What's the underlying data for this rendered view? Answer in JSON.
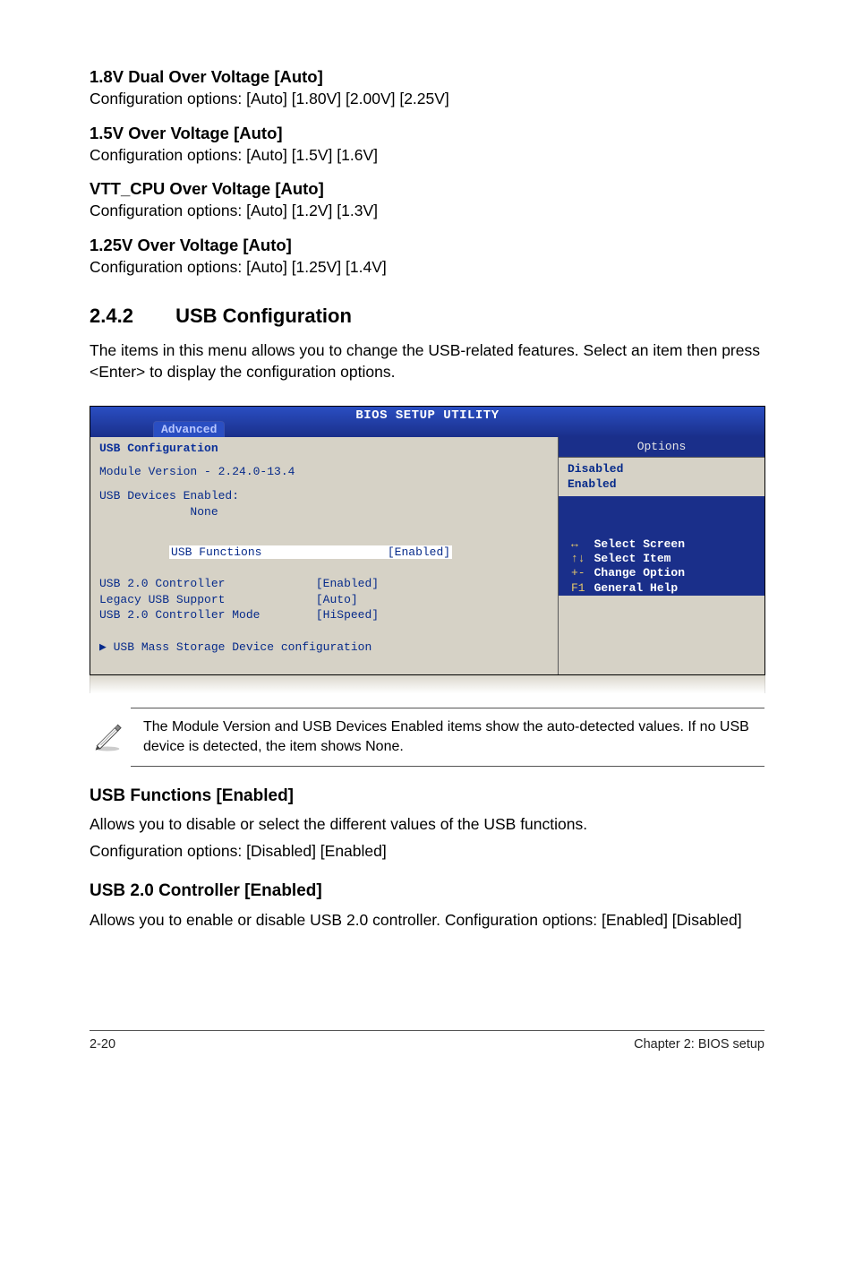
{
  "s1": {
    "h1": "1.8V Dual Over Voltage [Auto]",
    "p1": "Configuration options: [Auto] [1.80V] [2.00V] [2.25V]",
    "h2": "1.5V Over Voltage [Auto]",
    "p2": "Configuration options: [Auto] [1.5V] [1.6V]",
    "h3": "VTT_CPU Over Voltage [Auto]",
    "p3": "Configuration options: [Auto] [1.2V] [1.3V]",
    "h4": "1.25V Over Voltage [Auto]",
    "p4": "Configuration options: [Auto] [1.25V] [1.4V]"
  },
  "sec": {
    "num": "2.4.2",
    "title": "USB Configuration",
    "intro": "The items in this menu allows you to change the USB-related features. Select an item then press <Enter> to display the configuration options."
  },
  "bios": {
    "title": "BIOS SETUP UTILITY",
    "tab": "Advanced",
    "left": {
      "header": "USB Configuration",
      "module": "Module Version - 2.24.0-13.4",
      "devhdr": "USB Devices Enabled:",
      "devnone": "             None",
      "r1l": "USB Functions",
      "r1v": "[Enabled]",
      "r2l": "USB 2.0 Controller",
      "r2v": "[Enabled]",
      "r3l": "Legacy USB Support",
      "r3v": "[Auto]",
      "r4l": "USB 2.0 Controller Mode",
      "r4v": "[HiSpeed]",
      "sub": "USB Mass Storage Device configuration"
    },
    "right": {
      "opt_title": "Options",
      "opt1": "Disabled",
      "opt2": "Enabled",
      "help_k": "↔\n↑↓\n+-\nF1",
      "help_l": "Select Screen\nSelect Item\nChange Option\nGeneral Help"
    }
  },
  "note": "The Module Version and USB Devices Enabled items show the auto-detected values. If no USB device is detected, the item shows None.",
  "usbfun": {
    "h": "USB Functions [Enabled]",
    "p1": "Allows you to disable or select the different values of the USB functions.",
    "p2": "Configuration options: [Disabled] [Enabled]"
  },
  "usb20": {
    "h": "USB 2.0 Controller [Enabled]",
    "p": "Allows you to enable or disable USB 2.0 controller. Configuration options: [Enabled] [Disabled]"
  },
  "footer": {
    "left": "2-20",
    "right": "Chapter 2: BIOS setup"
  }
}
